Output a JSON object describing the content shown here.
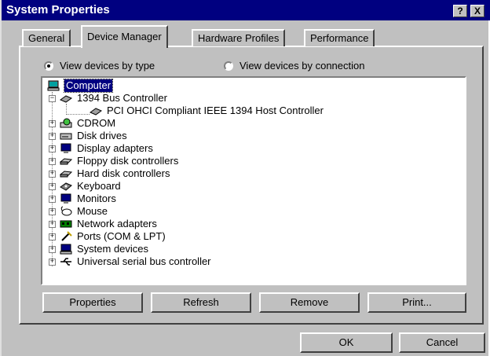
{
  "window": {
    "title": "System Properties",
    "help_glyph": "?",
    "close_glyph": "X"
  },
  "tabs": [
    {
      "label": "General"
    },
    {
      "label": "Device Manager"
    },
    {
      "label": "Hardware Profiles"
    },
    {
      "label": "Performance"
    }
  ],
  "view": {
    "by_type_label": "View devices by type",
    "by_connection_label": "View devices by connection",
    "selected": "by_type"
  },
  "tree": {
    "root": "Computer",
    "items": [
      {
        "label": "1394 Bus Controller",
        "icon": "bus-icon",
        "expanded": true,
        "children": [
          {
            "label": "PCI OHCI Compliant IEEE 1394 Host Controller",
            "icon": "bus-icon"
          }
        ]
      },
      {
        "label": "CDROM",
        "icon": "cdrom-icon"
      },
      {
        "label": "Disk drives",
        "icon": "disk-icon"
      },
      {
        "label": "Display adapters",
        "icon": "display-icon"
      },
      {
        "label": "Floppy disk controllers",
        "icon": "controller-icon"
      },
      {
        "label": "Hard disk controllers",
        "icon": "controller-icon"
      },
      {
        "label": "Keyboard",
        "icon": "keyboard-icon"
      },
      {
        "label": "Monitors",
        "icon": "monitor-icon"
      },
      {
        "label": "Mouse",
        "icon": "mouse-icon"
      },
      {
        "label": "Network adapters",
        "icon": "network-icon"
      },
      {
        "label": "Ports (COM & LPT)",
        "icon": "port-icon"
      },
      {
        "label": "System devices",
        "icon": "system-icon"
      },
      {
        "label": "Universal serial bus controller",
        "icon": "usb-icon"
      }
    ]
  },
  "buttons": {
    "properties": "Properties",
    "refresh": "Refresh",
    "remove": "Remove",
    "print": "Print...",
    "ok": "OK",
    "cancel": "Cancel"
  }
}
